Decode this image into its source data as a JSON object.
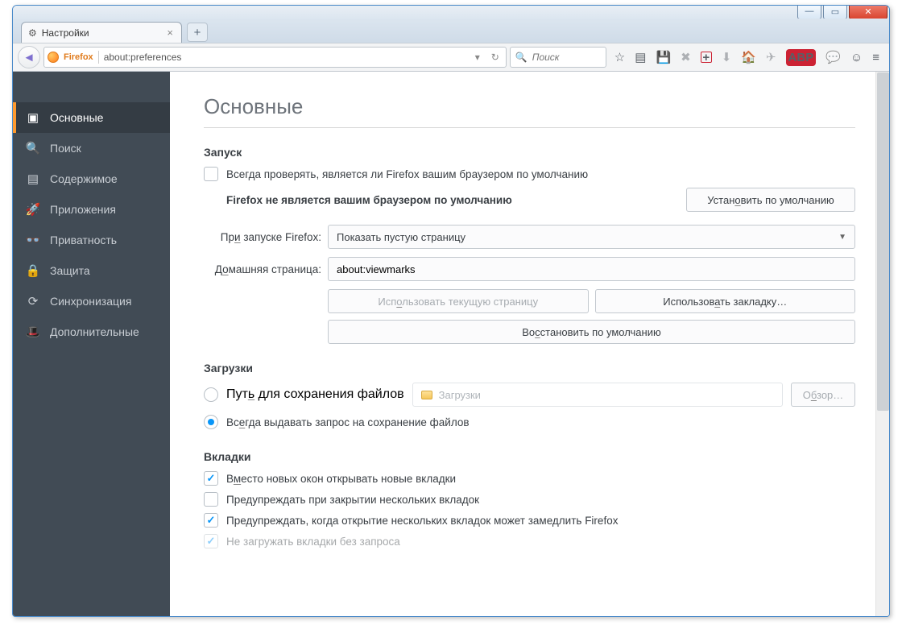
{
  "window": {
    "tab_title": "Настройки",
    "url_brand": "Firefox",
    "url": "about:preferences",
    "search_placeholder": "Поиск"
  },
  "sidebar": {
    "items": [
      {
        "label": "Основные",
        "active": true
      },
      {
        "label": "Поиск",
        "active": false
      },
      {
        "label": "Содержимое",
        "active": false
      },
      {
        "label": "Приложения",
        "active": false
      },
      {
        "label": "Приватность",
        "active": false
      },
      {
        "label": "Защита",
        "active": false
      },
      {
        "label": "Синхронизация",
        "active": false
      },
      {
        "label": "Дополнительные",
        "active": false
      }
    ]
  },
  "main": {
    "title": "Основные",
    "startup": {
      "heading": "Запуск",
      "always_check_label": "Всегда проверять, является ли Firefox вашим браузером по умолчанию",
      "default_status": "Firefox не является вашим браузером по умолчанию",
      "set_default_btn": "Установить по умолчанию",
      "on_startup_label": "При запуске Firefox:",
      "on_startup_value": "Показать пустую страницу",
      "homepage_label": "Домашняя страница:",
      "homepage_value": "about:viewmarks",
      "use_current_btn": "Использовать текущую страницу",
      "use_bookmark_btn": "Использовать закладку…",
      "restore_default_btn": "Восстановить по умолчанию"
    },
    "downloads": {
      "heading": "Загрузки",
      "save_to_label": "Путь для сохранения файлов",
      "save_to_path": "Загрузки",
      "browse_btn": "Обзор…",
      "always_ask_label": "Всегда выдавать запрос на сохранение файлов"
    },
    "tabs": {
      "heading": "Вкладки",
      "open_in_tabs": "Вместо новых окон открывать новые вкладки",
      "warn_close_multiple": "Предупреждать при закрытии нескольких вкладок",
      "warn_slow": "Предупреждать, когда открытие нескольких вкладок может замедлить Firefox",
      "dont_load_until": "Не загружать вкладки без запроса"
    }
  }
}
